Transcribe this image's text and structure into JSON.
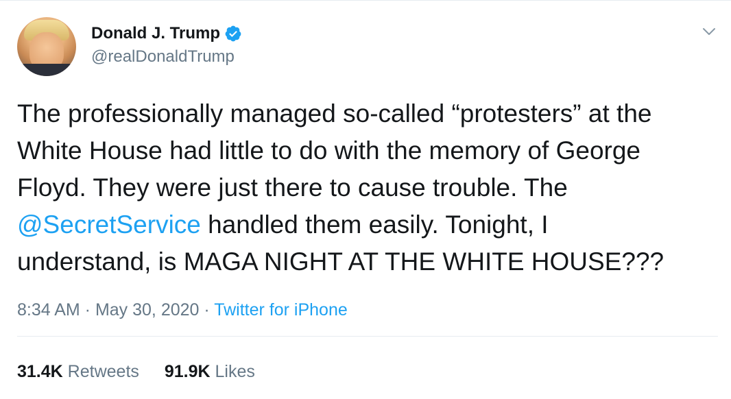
{
  "user": {
    "display_name": "Donald J. Trump",
    "handle": "@realDonaldTrump",
    "verified": true,
    "avatar_icon": "profile-photo"
  },
  "tweet": {
    "line1": "The professionally managed so-called “protesters” at the",
    "line2": "White House had little to do with the memory of George",
    "line3": "Floyd. They were just there to cause trouble. The",
    "mention": "@SecretService",
    "line4_rest": " handled them easily. Tonight, I",
    "line5": "understand, is MAGA NIGHT AT THE WHITE HOUSE???"
  },
  "meta": {
    "time": "8:34 AM",
    "sep1": " · ",
    "date": "May 30, 2020",
    "sep2": " · ",
    "source": "Twitter for iPhone"
  },
  "stats": {
    "retweets_count": "31.4K",
    "retweets_label": "Retweets",
    "likes_count": "91.9K",
    "likes_label": "Likes"
  },
  "colors": {
    "accent": "#1da1f2",
    "text": "#14171a",
    "muted": "#657786",
    "border": "#e6ecf0"
  },
  "icons": {
    "verified": "verified-badge-icon",
    "menu": "chevron-down-icon"
  }
}
